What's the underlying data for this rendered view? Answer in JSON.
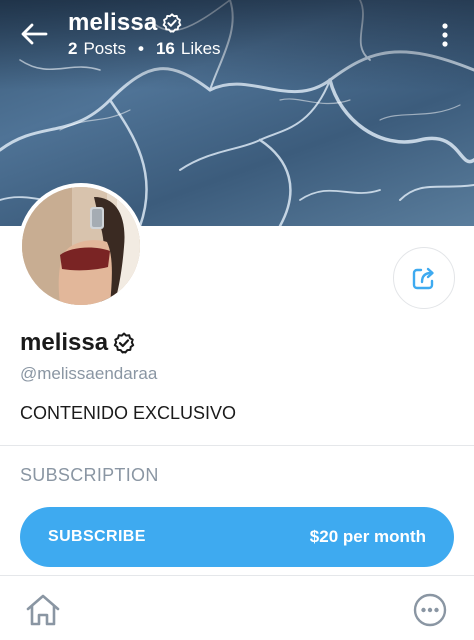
{
  "header": {
    "name": "melissa",
    "posts_count": "2",
    "posts_label": "Posts",
    "separator": "•",
    "likes_count": "16",
    "likes_label": "Likes"
  },
  "profile": {
    "name": "melissa",
    "handle": "@melissaendaraa",
    "bio": "CONTENIDO EXCLUSIVO"
  },
  "subscription": {
    "heading": "SUBSCRIPTION",
    "button_label": "SUBSCRIBE",
    "price": "$20 per month"
  },
  "icons": {
    "back": "arrow-left-icon",
    "menu": "vertical-dots-icon",
    "verified": "verified-badge-icon",
    "share": "share-icon",
    "home": "home-icon",
    "more": "more-horizontal-icon"
  },
  "colors": {
    "accent": "#3eaaf0",
    "muted_text": "#8a96a3",
    "text": "#1a1a1a"
  }
}
